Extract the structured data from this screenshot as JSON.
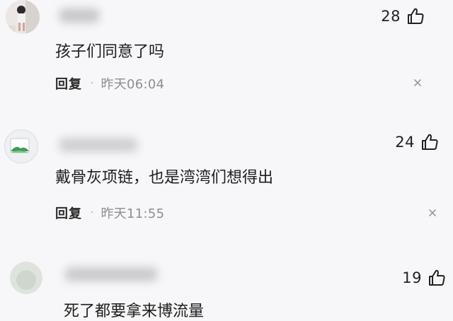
{
  "comments": [
    {
      "likes": "28",
      "text": "孩子们同意了吗",
      "reply_label": "回复",
      "time": "昨天06:04",
      "avatar_icon": "avatar-photo-icon"
    },
    {
      "likes": "24",
      "text": "戴骨灰项链，也是湾湾们想得出",
      "reply_label": "回复",
      "time": "昨天11:55",
      "avatar_icon": "avatar-image-placeholder-icon"
    },
    {
      "likes": "19",
      "text": "死了都要拿来博流量",
      "avatar_icon": "avatar-blurred-icon"
    }
  ],
  "colors": {
    "background": "#f7f7f9",
    "meta_text": "#8e8e8e",
    "reply_text": "#2a2a2a"
  }
}
